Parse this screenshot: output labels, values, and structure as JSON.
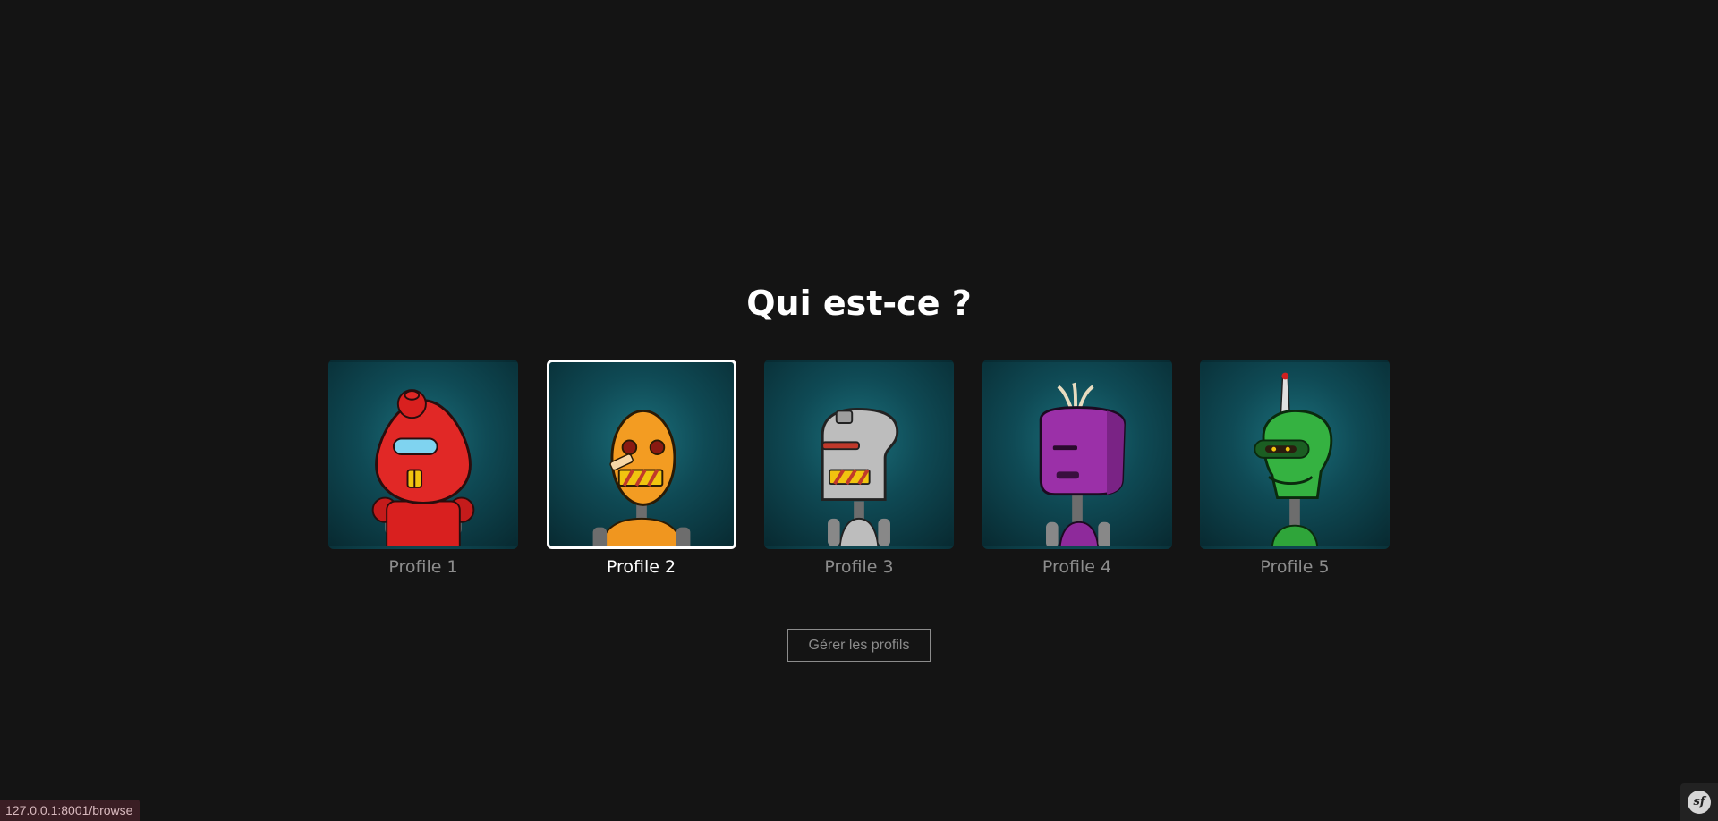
{
  "page": {
    "title": "Qui est-ce ?",
    "background": "#141414"
  },
  "profiles": [
    {
      "name": "Profile 1",
      "selected": false,
      "robot_color": "#d9201f",
      "avatar": "red-robot-avatar"
    },
    {
      "name": "Profile 2",
      "selected": true,
      "robot_color": "#f0961f",
      "avatar": "orange-robot-avatar"
    },
    {
      "name": "Profile 3",
      "selected": false,
      "robot_color": "#bdbdbd",
      "avatar": "gray-robot-avatar"
    },
    {
      "name": "Profile 4",
      "selected": false,
      "robot_color": "#8e2a9b",
      "avatar": "purple-robot-avatar"
    },
    {
      "name": "Profile 5",
      "selected": false,
      "robot_color": "#2fa53a",
      "avatar": "green-robot-avatar"
    }
  ],
  "manage_button": {
    "label": "Gérer les profils"
  },
  "status_bar": {
    "url": "127.0.0.1:8001/browse"
  },
  "debug_toolbar": {
    "logo_text": "sf",
    "icon": "symfony-logo-icon"
  }
}
